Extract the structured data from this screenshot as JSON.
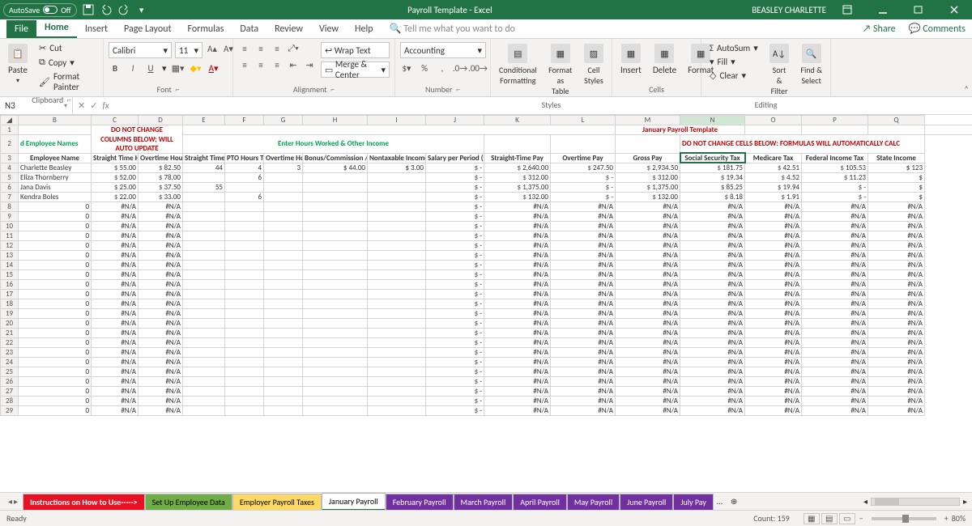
{
  "titlebar": {
    "autosave": "AutoSave",
    "off": "Off",
    "title": "Payroll Template  -  Excel",
    "user": "BEASLEY CHARLETTE"
  },
  "tabs": {
    "file": "File",
    "home": "Home",
    "insert": "Insert",
    "pagelayout": "Page Layout",
    "formulas": "Formulas",
    "data": "Data",
    "review": "Review",
    "view": "View",
    "help": "Help",
    "tellme": "Tell me what you want to do",
    "share": "Share",
    "comments": "Comments"
  },
  "ribbon": {
    "paste": "Paste",
    "cut": "Cut",
    "copy": "Copy",
    "fmtpainter": "Format Painter",
    "clipboard": "Clipboard",
    "font_name": "Calibri",
    "font_size": "11",
    "font": "Font",
    "wrap": "Wrap Text",
    "merge": "Merge & Center",
    "alignment": "Alignment",
    "numfmt": "Accounting",
    "number": "Number",
    "condfmt": "Conditional Formatting",
    "fmtastable": "Format as Table",
    "cellstyles": "Cell Styles",
    "styles": "Styles",
    "insert": "Insert",
    "delete": "Delete",
    "format": "Format",
    "cells": "Cells",
    "autosum": "AutoSum",
    "fill": "Fill",
    "clear": "Clear",
    "sortfilter": "Sort & Filter",
    "findselect": "Find & Select",
    "editing": "Editing"
  },
  "namebox": "N3",
  "fx": "fx",
  "cols": [
    "",
    "B",
    "C",
    "D",
    "E",
    "F",
    "G",
    "H",
    "I",
    "J",
    "K",
    "L",
    "M",
    "N",
    "O",
    "P",
    "Q"
  ],
  "row1_title": "January Payroll Template",
  "row2": {
    "b": "d Employee Names",
    "warn1": "DO NOT CHANGE",
    "warn2": "COLUMNS BELOW; WILL",
    "warn3": "AUTO UPDATE",
    "enter": "Enter Hours Worked & Other Income",
    "dnc": "DO NOT CHANGE CELLS BELOW: FORMULAS WILL AUTOMATICALLY CALC"
  },
  "headers": {
    "b": "Employee Name",
    "c": "Straight Time Hourly Rate",
    "d": "Overtime Hourly Rate",
    "e": "Straight Time Hours Worked",
    "f": "PTO Hours Taken",
    "g": "Overtime Hours Worked",
    "h": "Bonus/Commission /Other Taxable Income",
    "i": "Nontaxable Income, i.e., Reimbursements",
    "j": "Salary per Period (for salaried workers only)",
    "k": "Straight-Time Pay",
    "l": "Overtime Pay",
    "m": "Gross Pay",
    "n": "Social Security Tax",
    "o": "Medicare Tax",
    "p": "Federal Income Tax",
    "q": "State Income"
  },
  "data_rows": [
    {
      "n": "4",
      "b": "Charlette Beasley",
      "c": "55.00",
      "d": "82.50",
      "e": "44",
      "f": "4",
      "g": "3",
      "h": "44.00",
      "i": "3.00",
      "k": "2,640.00",
      "l": "247.50",
      "m": "2,934.50",
      "nn": "181.75",
      "o": "42.51",
      "p": "105.53",
      "q": "123"
    },
    {
      "n": "5",
      "b": "Eliza Thornberry",
      "c": "52.00",
      "d": "78.00",
      "e": "",
      "f": "6",
      "g": "",
      "h": "",
      "i": "",
      "k": "312.00",
      "l": "-",
      "m": "312.00",
      "nn": "19.34",
      "o": "4.52",
      "p": "11.23",
      "q": ""
    },
    {
      "n": "6",
      "b": "Jana Davis",
      "c": "25.00",
      "d": "37.50",
      "e": "55",
      "f": "",
      "g": "",
      "h": "",
      "i": "",
      "k": "1,375.00",
      "l": "-",
      "m": "1,375.00",
      "nn": "85.25",
      "o": "19.94",
      "p": "-",
      "q": ""
    },
    {
      "n": "7",
      "b": "Kendra Boles",
      "c": "22.00",
      "d": "33.00",
      "e": "",
      "f": "6",
      "g": "",
      "h": "",
      "i": "",
      "k": "132.00",
      "l": "-",
      "m": "132.00",
      "nn": "8.18",
      "o": "1.91",
      "p": "-",
      "q": ""
    }
  ],
  "na_rows": [
    8,
    9,
    10,
    11,
    12,
    13,
    14,
    15,
    16,
    17,
    18,
    19,
    20,
    21,
    22,
    23,
    24,
    25,
    26,
    27,
    28,
    29
  ],
  "na": "#N/A",
  "dash": "-",
  "zero": "0",
  "ds": "$",
  "sheets": {
    "s1": "Instructions on How to Use----->",
    "s2": "Set Up Employee Data",
    "s3": "Employer Payroll Taxes",
    "s4": "January Payroll",
    "s5": "February Payroll",
    "s6": "March Payroll",
    "s7": "April Payroll",
    "s8": "May Payroll",
    "s9": "June Payroll",
    "s10": "July Pay"
  },
  "status": {
    "ready": "Ready",
    "count": "Count: 159",
    "zoom": "80%"
  }
}
